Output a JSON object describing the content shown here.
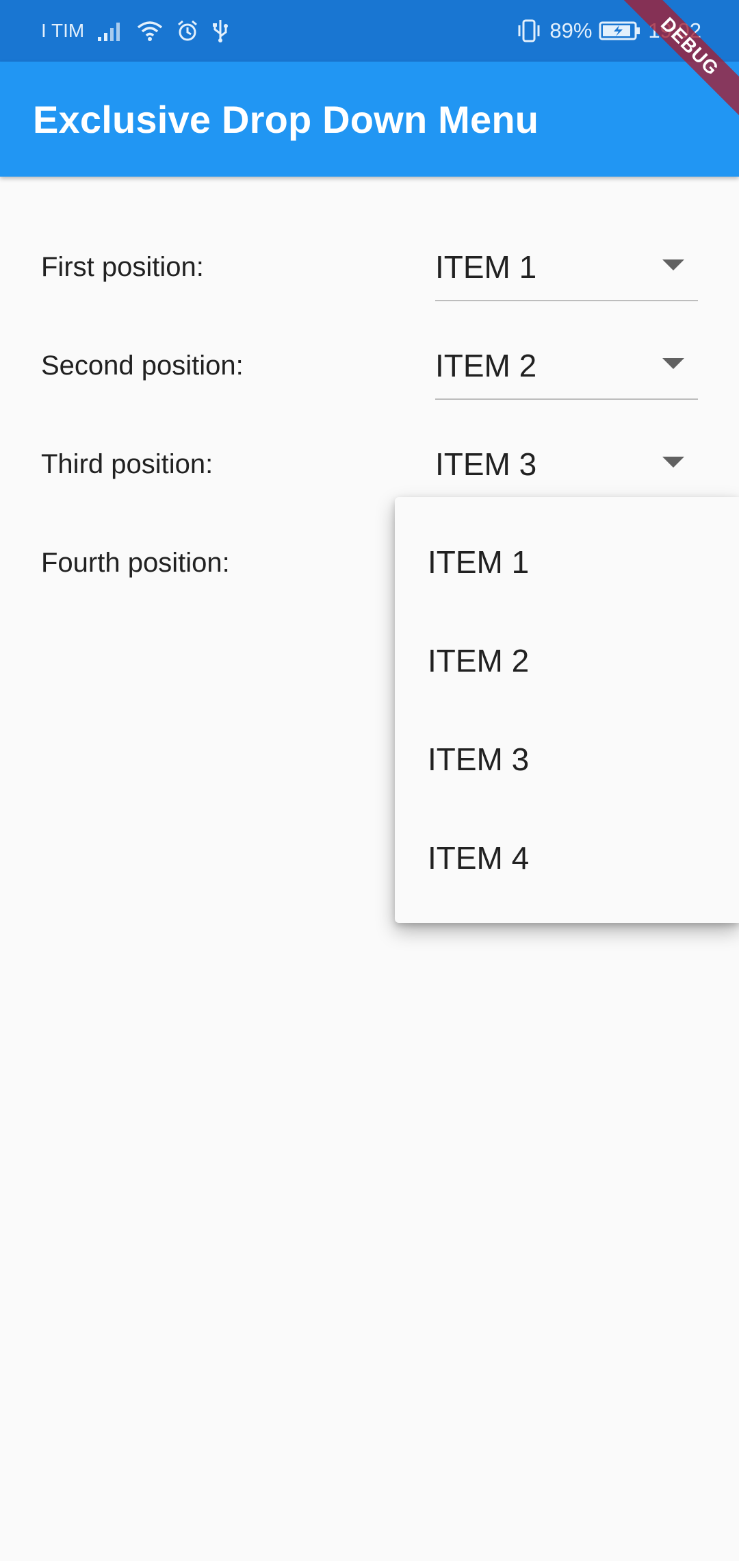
{
  "status_bar": {
    "carrier": "I TIM",
    "battery_percent": "89%",
    "time": "19:02",
    "icons": [
      "signal-icon",
      "wifi-icon",
      "alarm-icon",
      "usb-icon",
      "vibrate-icon",
      "battery-charging-icon"
    ]
  },
  "app_bar": {
    "title": "Exclusive Drop Down Menu"
  },
  "debug_banner": {
    "label": "DEBUG"
  },
  "rows": [
    {
      "label": "First position:",
      "value": "ITEM 1"
    },
    {
      "label": "Second position:",
      "value": "ITEM 2"
    },
    {
      "label": "Third position:",
      "value": "ITEM 3"
    },
    {
      "label": "Fourth position:",
      "value": ""
    }
  ],
  "dropdown_menu": {
    "items": [
      "ITEM 1",
      "ITEM 2",
      "ITEM 3",
      "ITEM 4"
    ]
  },
  "colors": {
    "status_bar": "#1976D2",
    "app_bar": "#2196F3",
    "background": "#FAFAFA",
    "text": "#212121",
    "underline": "#BDBDBD",
    "arrow": "#616161"
  }
}
